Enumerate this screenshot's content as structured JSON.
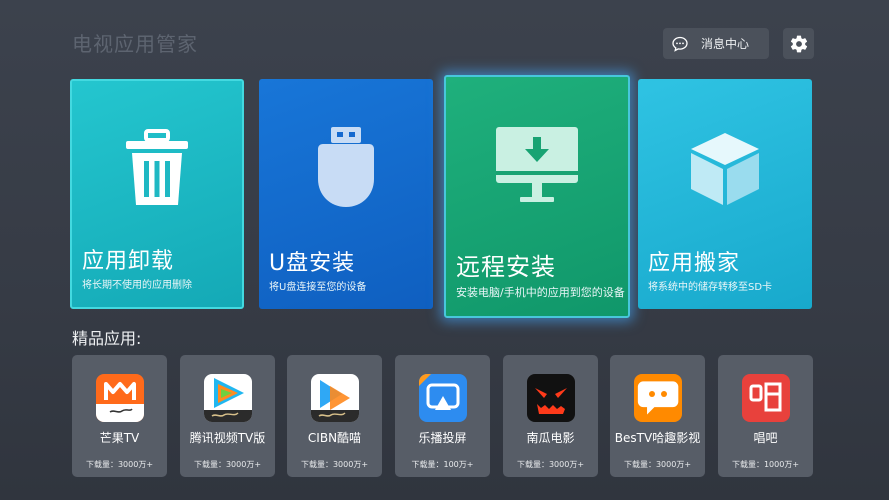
{
  "header": {
    "title": "电视应用管家",
    "message_center": "消息中心"
  },
  "tiles": [
    {
      "name": "应用卸载",
      "desc": "将长期不使用的应用删除",
      "icon": "trash-icon"
    },
    {
      "name": "U盘安装",
      "desc": "将U盘连接至您的设备",
      "icon": "usb-drive-icon"
    },
    {
      "name": "远程安装",
      "desc": "安装电脑/手机中的应用到您的设备",
      "icon": "monitor-download-icon"
    },
    {
      "name": "应用搬家",
      "desc": "将系统中的储存转移至SD卡",
      "icon": "cube-icon"
    }
  ],
  "featured": {
    "title": "精品应用:",
    "apps": [
      {
        "name": "芒果TV",
        "downloads": "下载量：3000万+",
        "icon": "mango-tv-icon",
        "color": "#ff6a1a"
      },
      {
        "name": "腾讯视频TV版",
        "downloads": "下载量：3000万+",
        "icon": "tencent-video-icon",
        "color": "#ffffff"
      },
      {
        "name": "CIBN酷喵",
        "downloads": "下载量：3000万+",
        "icon": "cibn-kumiao-icon",
        "color": "#ffffff"
      },
      {
        "name": "乐播投屏",
        "downloads": "下载量：100万+",
        "icon": "lebo-cast-icon",
        "color": "#2d8cf0"
      },
      {
        "name": "南瓜电影",
        "downloads": "下载量：3000万+",
        "icon": "pumpkin-movie-icon",
        "color": "#111111"
      },
      {
        "name": "BesTV哈趣影视",
        "downloads": "下载量：3000万+",
        "icon": "bestv-haqu-icon",
        "color": "#ff8a00"
      },
      {
        "name": "唱吧",
        "downloads": "下载量：1000万+",
        "icon": "changba-icon",
        "color": "#e8413c"
      }
    ]
  }
}
